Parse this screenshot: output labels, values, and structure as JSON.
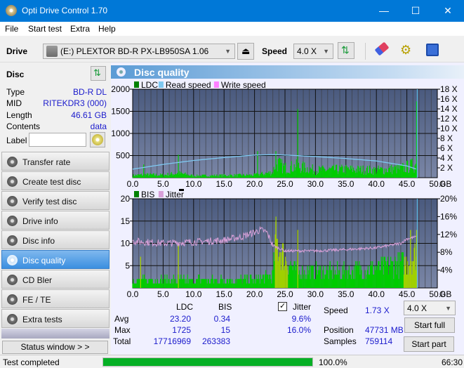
{
  "window": {
    "title": "Opti Drive Control 1.70",
    "minimize": "—",
    "maximize": "☐",
    "close": "✕"
  },
  "menu": [
    "File",
    "Start test",
    "Extra",
    "Help"
  ],
  "toolbar": {
    "drive_label": "Drive",
    "drive_value": "(E:)  PLEXTOR BD-R  PX-LB950SA 1.06",
    "speed_label": "Speed",
    "speed_value": "4.0 X"
  },
  "disc": {
    "header": "Disc",
    "rows": [
      {
        "key": "Type",
        "value": "BD-R DL"
      },
      {
        "key": "MID",
        "value": "RITEKDR3 (000)"
      },
      {
        "key": "Length",
        "value": "46.61 GB"
      },
      {
        "key": "Contents",
        "value": "data"
      }
    ],
    "label_key": "Label",
    "label_value": ""
  },
  "nav": [
    {
      "label": "Transfer rate",
      "active": false
    },
    {
      "label": "Create test disc",
      "active": false
    },
    {
      "label": "Verify test disc",
      "active": false
    },
    {
      "label": "Drive info",
      "active": false
    },
    {
      "label": "Disc info",
      "active": false
    },
    {
      "label": "Disc quality",
      "active": true
    },
    {
      "label": "CD Bler",
      "active": false
    },
    {
      "label": "FE / TE",
      "active": false
    },
    {
      "label": "Extra tests",
      "active": false
    }
  ],
  "status_window_btn": "Status window > >",
  "main": {
    "title": "Disc quality"
  },
  "stats": {
    "col_ldc": "LDC",
    "col_bis": "BIS",
    "row_avg": "Avg",
    "row_max": "Max",
    "row_total": "Total",
    "ldc_avg": "23.20",
    "ldc_max": "1725",
    "ldc_total": "17716969",
    "bis_avg": "0.34",
    "bis_max": "15",
    "bis_total": "263383",
    "jitter_label": "Jitter",
    "jitter_checked": true,
    "jitter_avg": "9.6%",
    "jitter_max": "16.0%",
    "speed_label": "Speed",
    "speed_value": "1.73 X",
    "position_label": "Position",
    "position_value": "47731 MB",
    "samples_label": "Samples",
    "samples_value": "759114",
    "speed_select": "4.0 X",
    "start_full": "Start full",
    "start_part": "Start part"
  },
  "statusbar": {
    "text": "Test completed",
    "progress_pct": 100.0,
    "progress_text": "100.0%",
    "time": "66:30"
  },
  "colors": {
    "ldc": "#00cc00",
    "read_speed": "#7ec8f0",
    "write_speed": "#ff80ff",
    "bis": "#00cc00",
    "jitter": "#d8a0d8",
    "accent": "#0078d7"
  },
  "chart_data": [
    {
      "type": "bar",
      "title": "LDC / Read speed",
      "legend": [
        "LDC",
        "Read speed",
        "Write speed"
      ],
      "legend_position": "top-left",
      "xlabel": "GB",
      "x_ticks": [
        "0.0",
        "5.0",
        "10.0",
        "15.0",
        "20.0",
        "25.0",
        "30.0",
        "35.0",
        "40.0",
        "45.0",
        "50.0"
      ],
      "xlim": [
        0,
        50
      ],
      "y_ticks": [
        "500",
        "1000",
        "1500",
        "2000"
      ],
      "ylim": [
        0,
        2000
      ],
      "y2_ticks": [
        "2 X",
        "4 X",
        "6 X",
        "8 X",
        "10 X",
        "12 X",
        "14 X",
        "16 X",
        "18 X"
      ],
      "y2lim": [
        0,
        18
      ],
      "grid": true,
      "ldc_profile": [
        [
          0,
          60
        ],
        [
          2,
          80
        ],
        [
          5,
          70
        ],
        [
          7.5,
          120
        ],
        [
          10,
          50
        ],
        [
          15,
          60
        ],
        [
          20,
          70
        ],
        [
          23,
          140
        ],
        [
          23.5,
          400
        ],
        [
          25,
          260
        ],
        [
          27,
          300
        ],
        [
          30,
          200
        ],
        [
          35,
          220
        ],
        [
          40,
          200
        ],
        [
          44,
          240
        ],
        [
          46.6,
          350
        ]
      ],
      "ldc_spikes": [
        [
          1.8,
          300
        ],
        [
          7.5,
          520
        ],
        [
          20.5,
          600
        ],
        [
          23.5,
          600
        ],
        [
          27.1,
          1550
        ],
        [
          46.6,
          1725
        ]
      ],
      "read_speed": [
        [
          0,
          1.73
        ],
        [
          5,
          2.7
        ],
        [
          10,
          3.5
        ],
        [
          15,
          4.1
        ],
        [
          20,
          4.6
        ],
        [
          23.5,
          4.7
        ],
        [
          25,
          4.6
        ],
        [
          30,
          4.3
        ],
        [
          35,
          3.9
        ],
        [
          40,
          3.4
        ],
        [
          45,
          2.4
        ],
        [
          46.6,
          1.73
        ]
      ]
    },
    {
      "type": "bar",
      "title": "BIS / Jitter",
      "legend": [
        "BIS",
        "Jitter"
      ],
      "legend_position": "top-left",
      "xlabel": "GB",
      "x_ticks": [
        "0.0",
        "5.0",
        "10.0",
        "15.0",
        "20.0",
        "25.0",
        "30.0",
        "35.0",
        "40.0",
        "45.0",
        "50.0"
      ],
      "xlim": [
        0,
        50
      ],
      "y_ticks": [
        "5",
        "10",
        "15",
        "20"
      ],
      "ylim": [
        0,
        20
      ],
      "y2_ticks": [
        "4%",
        "8%",
        "12%",
        "16%",
        "20%"
      ],
      "y2lim": [
        0,
        20
      ],
      "grid": true,
      "bis_profile": [
        [
          0,
          2
        ],
        [
          5,
          2
        ],
        [
          10,
          2
        ],
        [
          15,
          2
        ],
        [
          20,
          2
        ],
        [
          23,
          3
        ],
        [
          23.5,
          12
        ],
        [
          25,
          7
        ],
        [
          27,
          4
        ],
        [
          30,
          4
        ],
        [
          35,
          4
        ],
        [
          40,
          5
        ],
        [
          44,
          6
        ],
        [
          46.6,
          8
        ]
      ],
      "bis_spikes": [
        [
          1.3,
          7
        ],
        [
          7.5,
          10
        ],
        [
          23.5,
          15
        ],
        [
          27.1,
          13
        ],
        [
          45.6,
          13
        ],
        [
          46.6,
          13
        ]
      ],
      "jitter": [
        [
          0,
          10.5
        ],
        [
          5,
          10
        ],
        [
          10,
          10.3
        ],
        [
          15,
          10.7
        ],
        [
          18,
          11.5
        ],
        [
          21,
          13
        ],
        [
          22,
          12.5
        ],
        [
          23,
          9.5
        ],
        [
          25,
          8.3
        ],
        [
          30,
          8.3
        ],
        [
          35,
          8.6
        ],
        [
          40,
          9
        ],
        [
          44,
          10
        ],
        [
          45,
          11
        ],
        [
          46.6,
          11.5
        ]
      ]
    }
  ]
}
